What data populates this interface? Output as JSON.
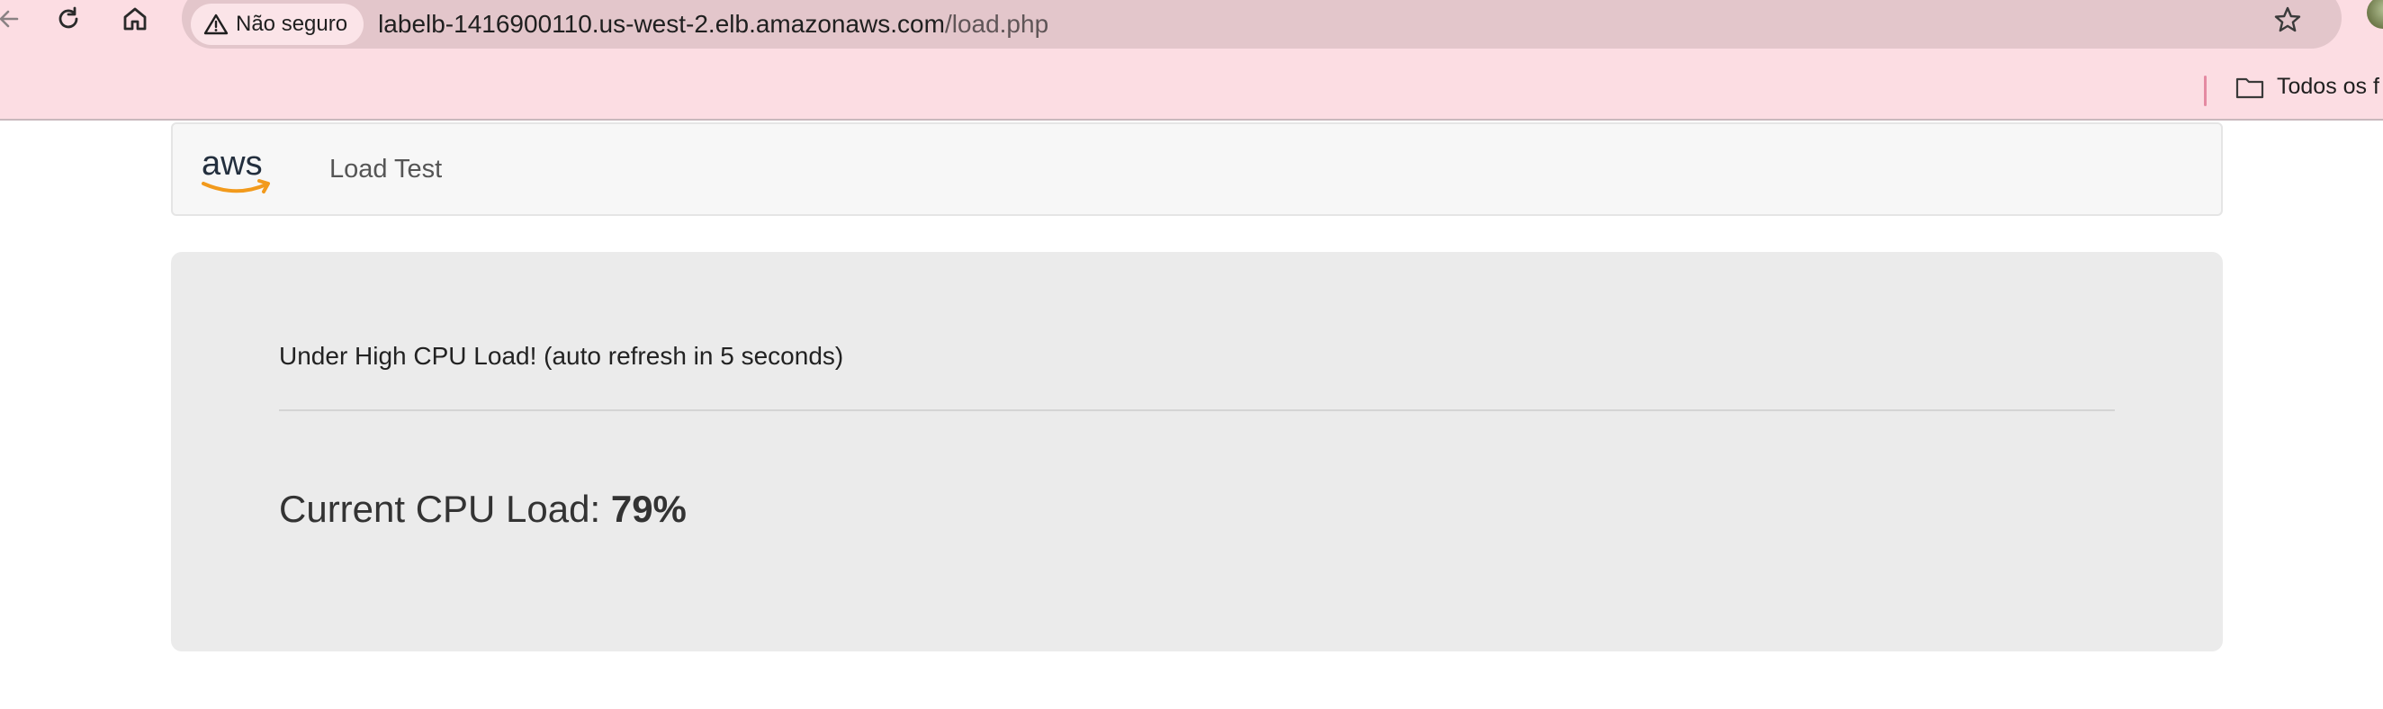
{
  "browser": {
    "security_label": "Não seguro",
    "url_host": "labelb-1416900110.us-west-2.elb.amazonaws.com",
    "url_path": "/load.php",
    "bookmark_folder_label": "Todos os f"
  },
  "icons": {
    "back": "arrow-left-icon",
    "reload": "reload-icon",
    "home": "home-icon",
    "warning": "warning-triangle-icon",
    "star": "star-icon",
    "folder": "folder-icon",
    "logo": "aws-logo"
  },
  "colors": {
    "toolbar_bg": "#fcdde3",
    "omnibox_bg": "#e3c6cb",
    "aws_smile": "#f29a1c",
    "aws_text": "#232f3e",
    "panel_bg": "#ebebeb"
  },
  "navbar": {
    "logo_text": "aws",
    "brand_title": "Load Test"
  },
  "main": {
    "status_message": "Under High CPU Load! (auto refresh in 5 seconds)",
    "cpu_label": "Current CPU Load: ",
    "cpu_value": "79%"
  }
}
